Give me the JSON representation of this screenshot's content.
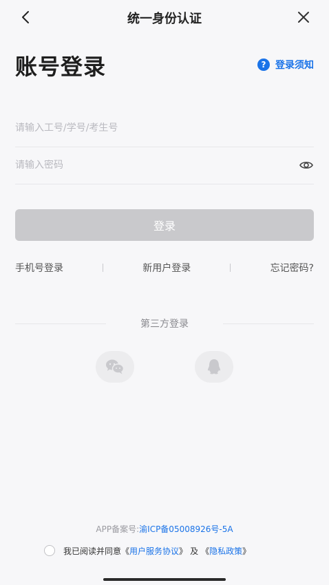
{
  "header": {
    "title": "统一身份认证"
  },
  "page": {
    "heading": "账号登录",
    "notice_label": "登录须知"
  },
  "form": {
    "account_placeholder": "请输入工号/学号/考生号",
    "password_placeholder": "请输入密码",
    "login_label": "登录"
  },
  "links": {
    "phone_login": "手机号登录",
    "new_user": "新用户登录",
    "forgot": "忘记密码?"
  },
  "third_party": {
    "title": "第三方登录",
    "options": [
      "wechat-icon",
      "qq-icon"
    ]
  },
  "footer": {
    "record_prefix": "APP备案号:",
    "record_number": "渝ICP备05008926号-5A",
    "agree_text": "我已阅读并同意",
    "open_quote": "《",
    "user_agreement": "用户服务协议",
    "close_quote": "》",
    "and": "及",
    "privacy_policy": "隐私政策"
  },
  "colors": {
    "accent": "#1a73e8",
    "button_disabled": "#c9c9cc",
    "background": "#f7f7f9"
  }
}
